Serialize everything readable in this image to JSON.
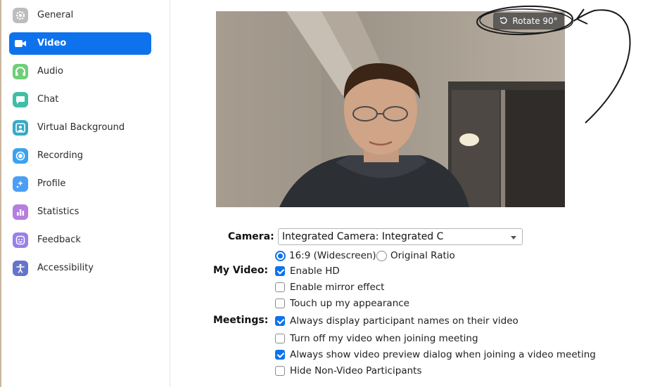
{
  "sidebar": {
    "items": [
      {
        "label": "General",
        "icon": "gear-icon",
        "color": "#b8b8b8",
        "active": false
      },
      {
        "label": "Video",
        "icon": "video-camera-icon",
        "color": "#0e72ed",
        "active": true
      },
      {
        "label": "Audio",
        "icon": "headphones-icon",
        "color": "#6fcf77",
        "active": false
      },
      {
        "label": "Chat",
        "icon": "chat-bubble-icon",
        "color": "#3fbfa6",
        "active": false
      },
      {
        "label": "Virtual Background",
        "icon": "virtual-background-icon",
        "color": "#36aac9",
        "active": false
      },
      {
        "label": "Recording",
        "icon": "record-icon",
        "color": "#3aa2ef",
        "active": false
      },
      {
        "label": "Profile",
        "icon": "profile-icon",
        "color": "#4a9ff5",
        "active": false
      },
      {
        "label": "Statistics",
        "icon": "statistics-icon",
        "color": "#b57ee0",
        "active": false
      },
      {
        "label": "Feedback",
        "icon": "smiley-icon",
        "color": "#9b7fe8",
        "active": false
      },
      {
        "label": "Accessibility",
        "icon": "accessibility-icon",
        "color": "#6475c9",
        "active": false
      }
    ]
  },
  "preview": {
    "rotate_label": "Rotate 90°"
  },
  "camera": {
    "label": "Camera:",
    "selected": "Integrated Camera: Integrated C"
  },
  "my_video": {
    "label": "My Video:",
    "aspect_options": [
      {
        "label": "16:9 (Widescreen)",
        "selected": true
      },
      {
        "label": "Original Ratio",
        "selected": false
      }
    ],
    "checkboxes": [
      {
        "label": "Enable HD",
        "checked": true
      },
      {
        "label": "Enable mirror effect",
        "checked": false
      },
      {
        "label": "Touch up my appearance",
        "checked": false
      }
    ]
  },
  "meetings": {
    "label": "Meetings:",
    "checkboxes": [
      {
        "label": "Always display participant names on their video",
        "checked": true
      },
      {
        "label": "Turn off my video when joining meeting",
        "checked": false
      },
      {
        "label": "Always show video preview dialog when joining a video meeting",
        "checked": true
      },
      {
        "label": "Hide Non-Video Participants",
        "checked": false
      }
    ]
  },
  "accent_color": "#0e72ed"
}
